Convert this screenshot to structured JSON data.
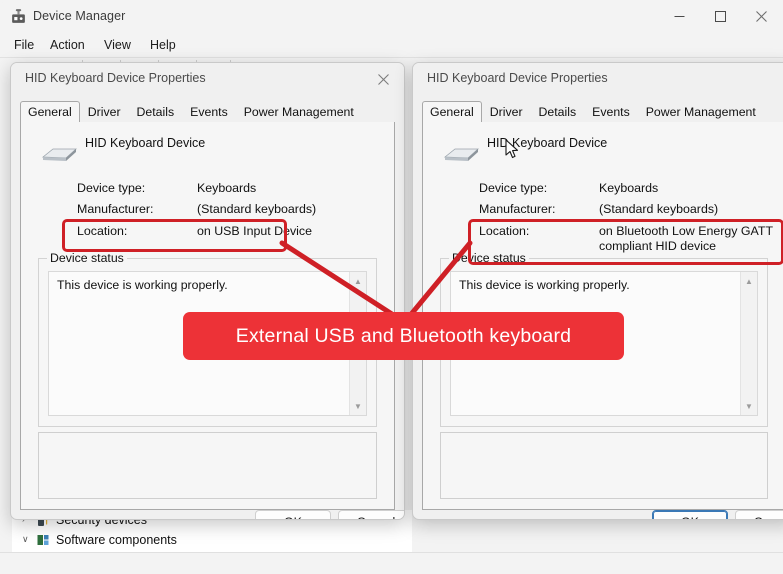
{
  "window": {
    "title": "Device Manager",
    "icon": "device-manager-icon",
    "controls": {
      "minimize": "─",
      "maximize": "□",
      "close": "✕"
    },
    "menus": [
      "File",
      "Action",
      "View",
      "Help"
    ]
  },
  "tree": {
    "items": [
      {
        "label": "Security devices",
        "chevron": "›"
      },
      {
        "label": "Software components",
        "chevron": "∨"
      }
    ]
  },
  "dialog_left": {
    "title": "HID Keyboard Device Properties",
    "close_glyph": "✕",
    "tabs": [
      "General",
      "Driver",
      "Details",
      "Events",
      "Power Management"
    ],
    "active_tab": "General",
    "device_name": "HID Keyboard Device",
    "fields": [
      {
        "label": "Device type:",
        "value": "Keyboards"
      },
      {
        "label": "Manufacturer:",
        "value": "(Standard keyboards)"
      },
      {
        "label": "Location:",
        "value": "on USB Input Device"
      }
    ],
    "status_group_label": "Device status",
    "status_text": "This device is working properly.",
    "scroll_up": "▲",
    "scroll_down": "▼",
    "buttons": {
      "ok": "OK",
      "cancel": "Cancel"
    }
  },
  "dialog_right": {
    "title": "HID Keyboard Device Properties",
    "tabs": [
      "General",
      "Driver",
      "Details",
      "Events",
      "Power Management"
    ],
    "active_tab": "General",
    "device_name": "HID Keyboard Device",
    "fields": [
      {
        "label": "Device type:",
        "value": "Keyboards"
      },
      {
        "label": "Manufacturer:",
        "value": "(Standard keyboards)"
      },
      {
        "label": "Location:",
        "value": "on Bluetooth Low Energy GATT compliant HID device"
      }
    ],
    "status_group_label": "Device status",
    "status_text": "This device is working properly.",
    "scroll_up": "▲",
    "scroll_down": "▼",
    "buttons": {
      "ok": "OK",
      "cancel": "Cancel"
    }
  },
  "annotation": {
    "callout_text": "External USB and Bluetooth keyboard",
    "callout_color": "#ed3237",
    "highlight_color": "#cf2026"
  }
}
